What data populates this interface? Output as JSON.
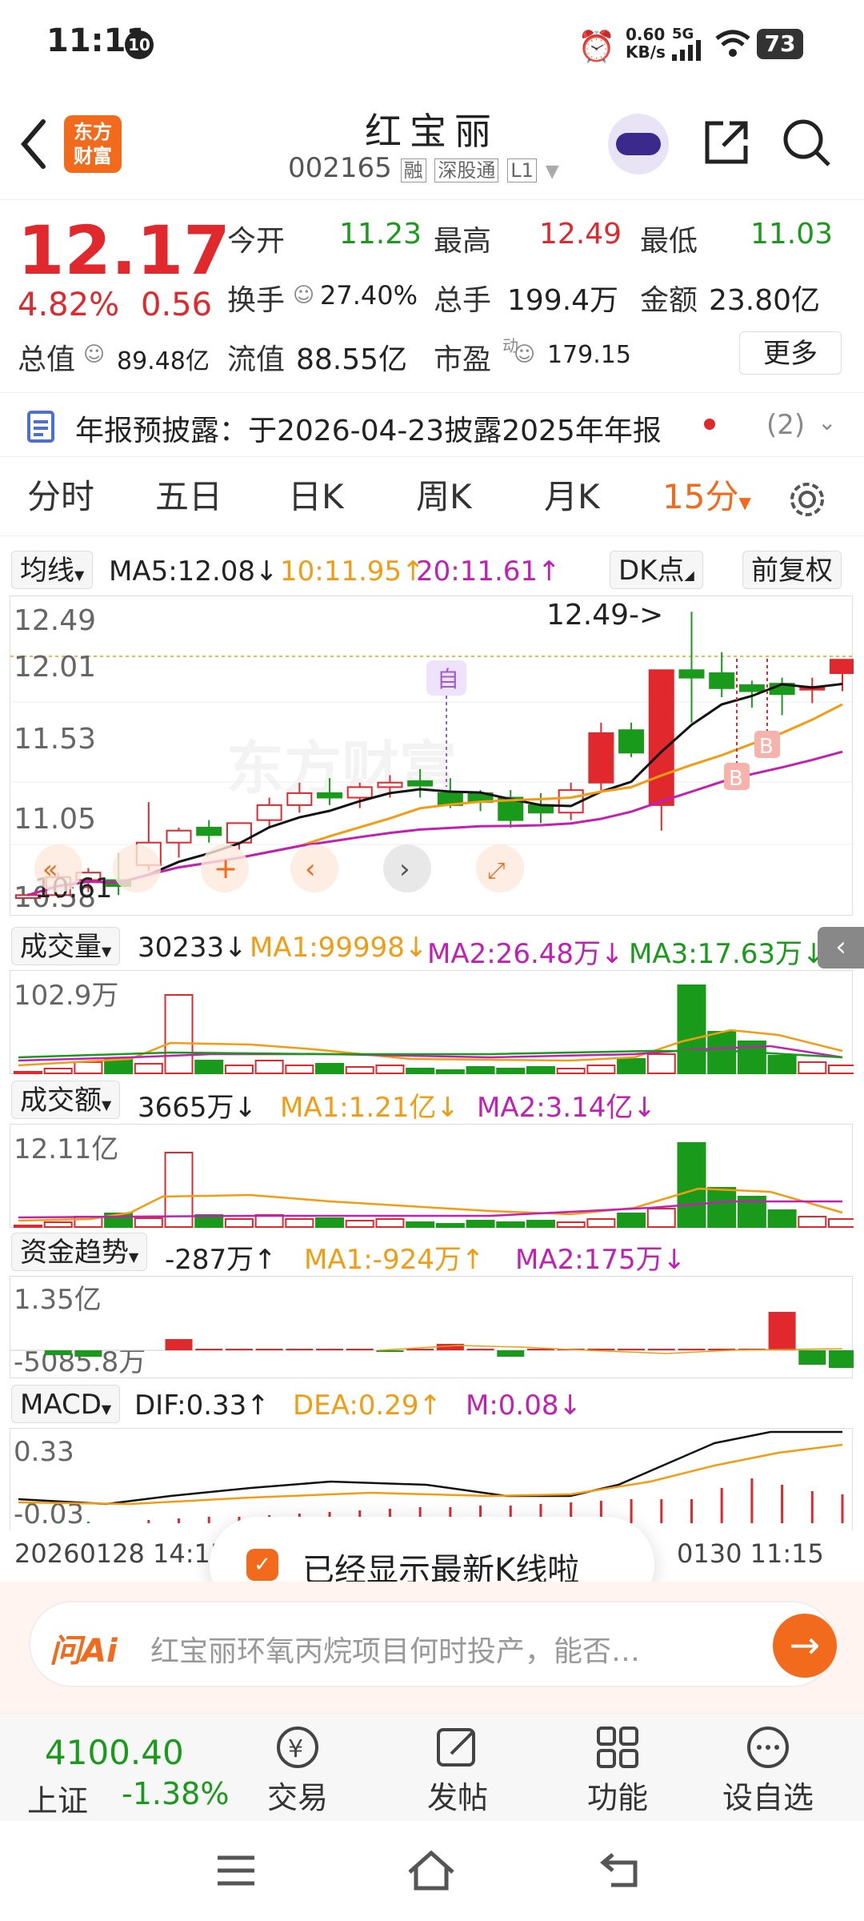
{
  "status_bar": {
    "time": "11:11",
    "notif_badge": "10",
    "net_speed_top": "0.60",
    "net_speed_bottom": "KB/s",
    "network": "5G",
    "battery": "73"
  },
  "header": {
    "brand_line1": "东方",
    "brand_line2": "财富",
    "title": "红宝丽",
    "code": "002165",
    "tag_margin": "融",
    "tag_connect": "深股通",
    "tag_level": "L1"
  },
  "quote": {
    "price": "12.17",
    "change_pct": "4.82%",
    "change_amt": "0.56",
    "open_label": "今开",
    "open": "11.23",
    "high_label": "最高",
    "high": "12.49",
    "low_label": "最低",
    "low": "11.03",
    "turnover_label": "换手",
    "turnover": "27.40%",
    "volume_label": "总手",
    "volume": "199.4万",
    "amount_label": "金额",
    "amount": "23.80亿",
    "mktcap_label": "总值",
    "mktcap": "89.48亿",
    "float_label": "流值",
    "float": "88.55亿",
    "pe_label": "市盈",
    "pe_sup": "动",
    "pe": "179.15",
    "more": "更多"
  },
  "notice": {
    "text": "年报预披露：于2026-04-23披露2025年年报",
    "count": "(2)"
  },
  "tabs": [
    "分时",
    "五日",
    "日K",
    "周K",
    "月K",
    "15分"
  ],
  "ma_bar": {
    "label": "均线",
    "ma5": "MA5:12.08",
    "ma5_arrow": "↓",
    "ma10": "10:11.95",
    "ma10_arrow": "↑",
    "ma20": "20:11.61",
    "ma20_arrow": "↑",
    "dk": "DK点",
    "fq": "前复权"
  },
  "kline_panel": {
    "y_labels": [
      "12.49",
      "12.01",
      "11.53",
      "11.05",
      "10.58"
    ],
    "high_marker": "12.49->",
    "low_marker": "10.61",
    "event_label": "自",
    "buy_label": "B",
    "watermark": "东方财富"
  },
  "volume_panel": {
    "label": "成交量",
    "value": "30233",
    "arrow": "↓",
    "ma1": "MA1:99998",
    "ma1_arrow": "↓",
    "ma2": "MA2:26.48万",
    "ma2_arrow": "↓",
    "ma3": "MA3:17.63万",
    "ma3_arrow": "↓",
    "max": "102.9万"
  },
  "amount_panel": {
    "label": "成交额",
    "value": "3665万",
    "arrow": "↓",
    "ma1": "MA1:1.21亿",
    "ma1_arrow": "↓",
    "ma2": "MA2:3.14亿",
    "ma2_arrow": "↓",
    "max": "12.11亿"
  },
  "fund_panel": {
    "label": "资金趋势",
    "value": "-287万",
    "arrow": "↑",
    "ma1": "MA1:-924万",
    "ma1_arrow": "↑",
    "ma2": "MA2:175万",
    "ma2_arrow": "↓",
    "max": "1.35亿",
    "min": "-5085.8万"
  },
  "macd_panel": {
    "label": "MACD",
    "dif": "DIF:0.33",
    "dif_arrow": "↑",
    "dea": "DEA:0.29",
    "dea_arrow": "↑",
    "m": "M:0.08",
    "m_arrow": "↓",
    "max": "0.33",
    "min": "-0.03"
  },
  "time_axis": {
    "start": "20260128 14:15",
    "end": "0130 11:15"
  },
  "toast": {
    "text": "已经显示最新K线啦"
  },
  "ai_bar": {
    "logo": "问Ai",
    "placeholder": "红宝丽环氧丙烷项目何时投产，能否…"
  },
  "bottom_nav": {
    "index_value": "4100.40",
    "index_name": "上证",
    "index_change": "-1.38%",
    "trade": "交易",
    "post": "发帖",
    "func": "功能",
    "watch": "设自选"
  },
  "colors": {
    "up": "#e0282d",
    "down": "#1a9a1a",
    "ma5": "#111111",
    "ma10": "#f39c12",
    "ma20": "#c21fb5",
    "accent": "#f26a1b"
  },
  "chart_data": {
    "type": "candlestick",
    "interval": "15分",
    "candles": [
      [
        10.58,
        10.61,
        10.58,
        10.6
      ],
      [
        10.6,
        10.75,
        10.58,
        10.72
      ],
      [
        10.7,
        10.78,
        10.62,
        10.75
      ],
      [
        10.7,
        10.88,
        10.6,
        10.66
      ],
      [
        10.8,
        11.22,
        10.76,
        10.95
      ],
      [
        10.95,
        11.05,
        10.85,
        11.03
      ],
      [
        11.05,
        11.1,
        10.95,
        11.0
      ],
      [
        10.95,
        11.08,
        10.9,
        11.08
      ],
      [
        11.1,
        11.25,
        11.05,
        11.2
      ],
      [
        11.2,
        11.35,
        11.15,
        11.28
      ],
      [
        11.28,
        11.38,
        11.2,
        11.25
      ],
      [
        11.25,
        11.35,
        11.18,
        11.32
      ],
      [
        11.32,
        11.4,
        11.25,
        11.35
      ],
      [
        11.36,
        11.44,
        11.25,
        11.33
      ],
      [
        11.28,
        11.38,
        11.18,
        11.2
      ],
      [
        11.28,
        11.3,
        11.16,
        11.22
      ],
      [
        11.25,
        11.3,
        11.05,
        11.1
      ],
      [
        11.2,
        11.28,
        11.08,
        11.15
      ],
      [
        11.15,
        11.35,
        11.1,
        11.3
      ],
      [
        11.35,
        11.75,
        11.3,
        11.68
      ],
      [
        11.7,
        11.75,
        11.52,
        11.55
      ],
      [
        11.2,
        12.1,
        11.03,
        12.1
      ],
      [
        12.1,
        12.49,
        11.75,
        12.05
      ],
      [
        12.08,
        12.22,
        11.92,
        11.98
      ],
      [
        12.0,
        12.03,
        11.85,
        11.96
      ],
      [
        12.01,
        12.05,
        11.8,
        11.94
      ],
      [
        11.97,
        12.05,
        11.88,
        11.99
      ],
      [
        12.08,
        12.08,
        11.96,
        12.17
      ]
    ],
    "volume_max": "102.9万",
    "amount_max": "12.11亿",
    "fund_max": "1.35亿",
    "fund_min": "-5085.8万",
    "macd_range": [
      -0.03,
      0.33
    ]
  }
}
